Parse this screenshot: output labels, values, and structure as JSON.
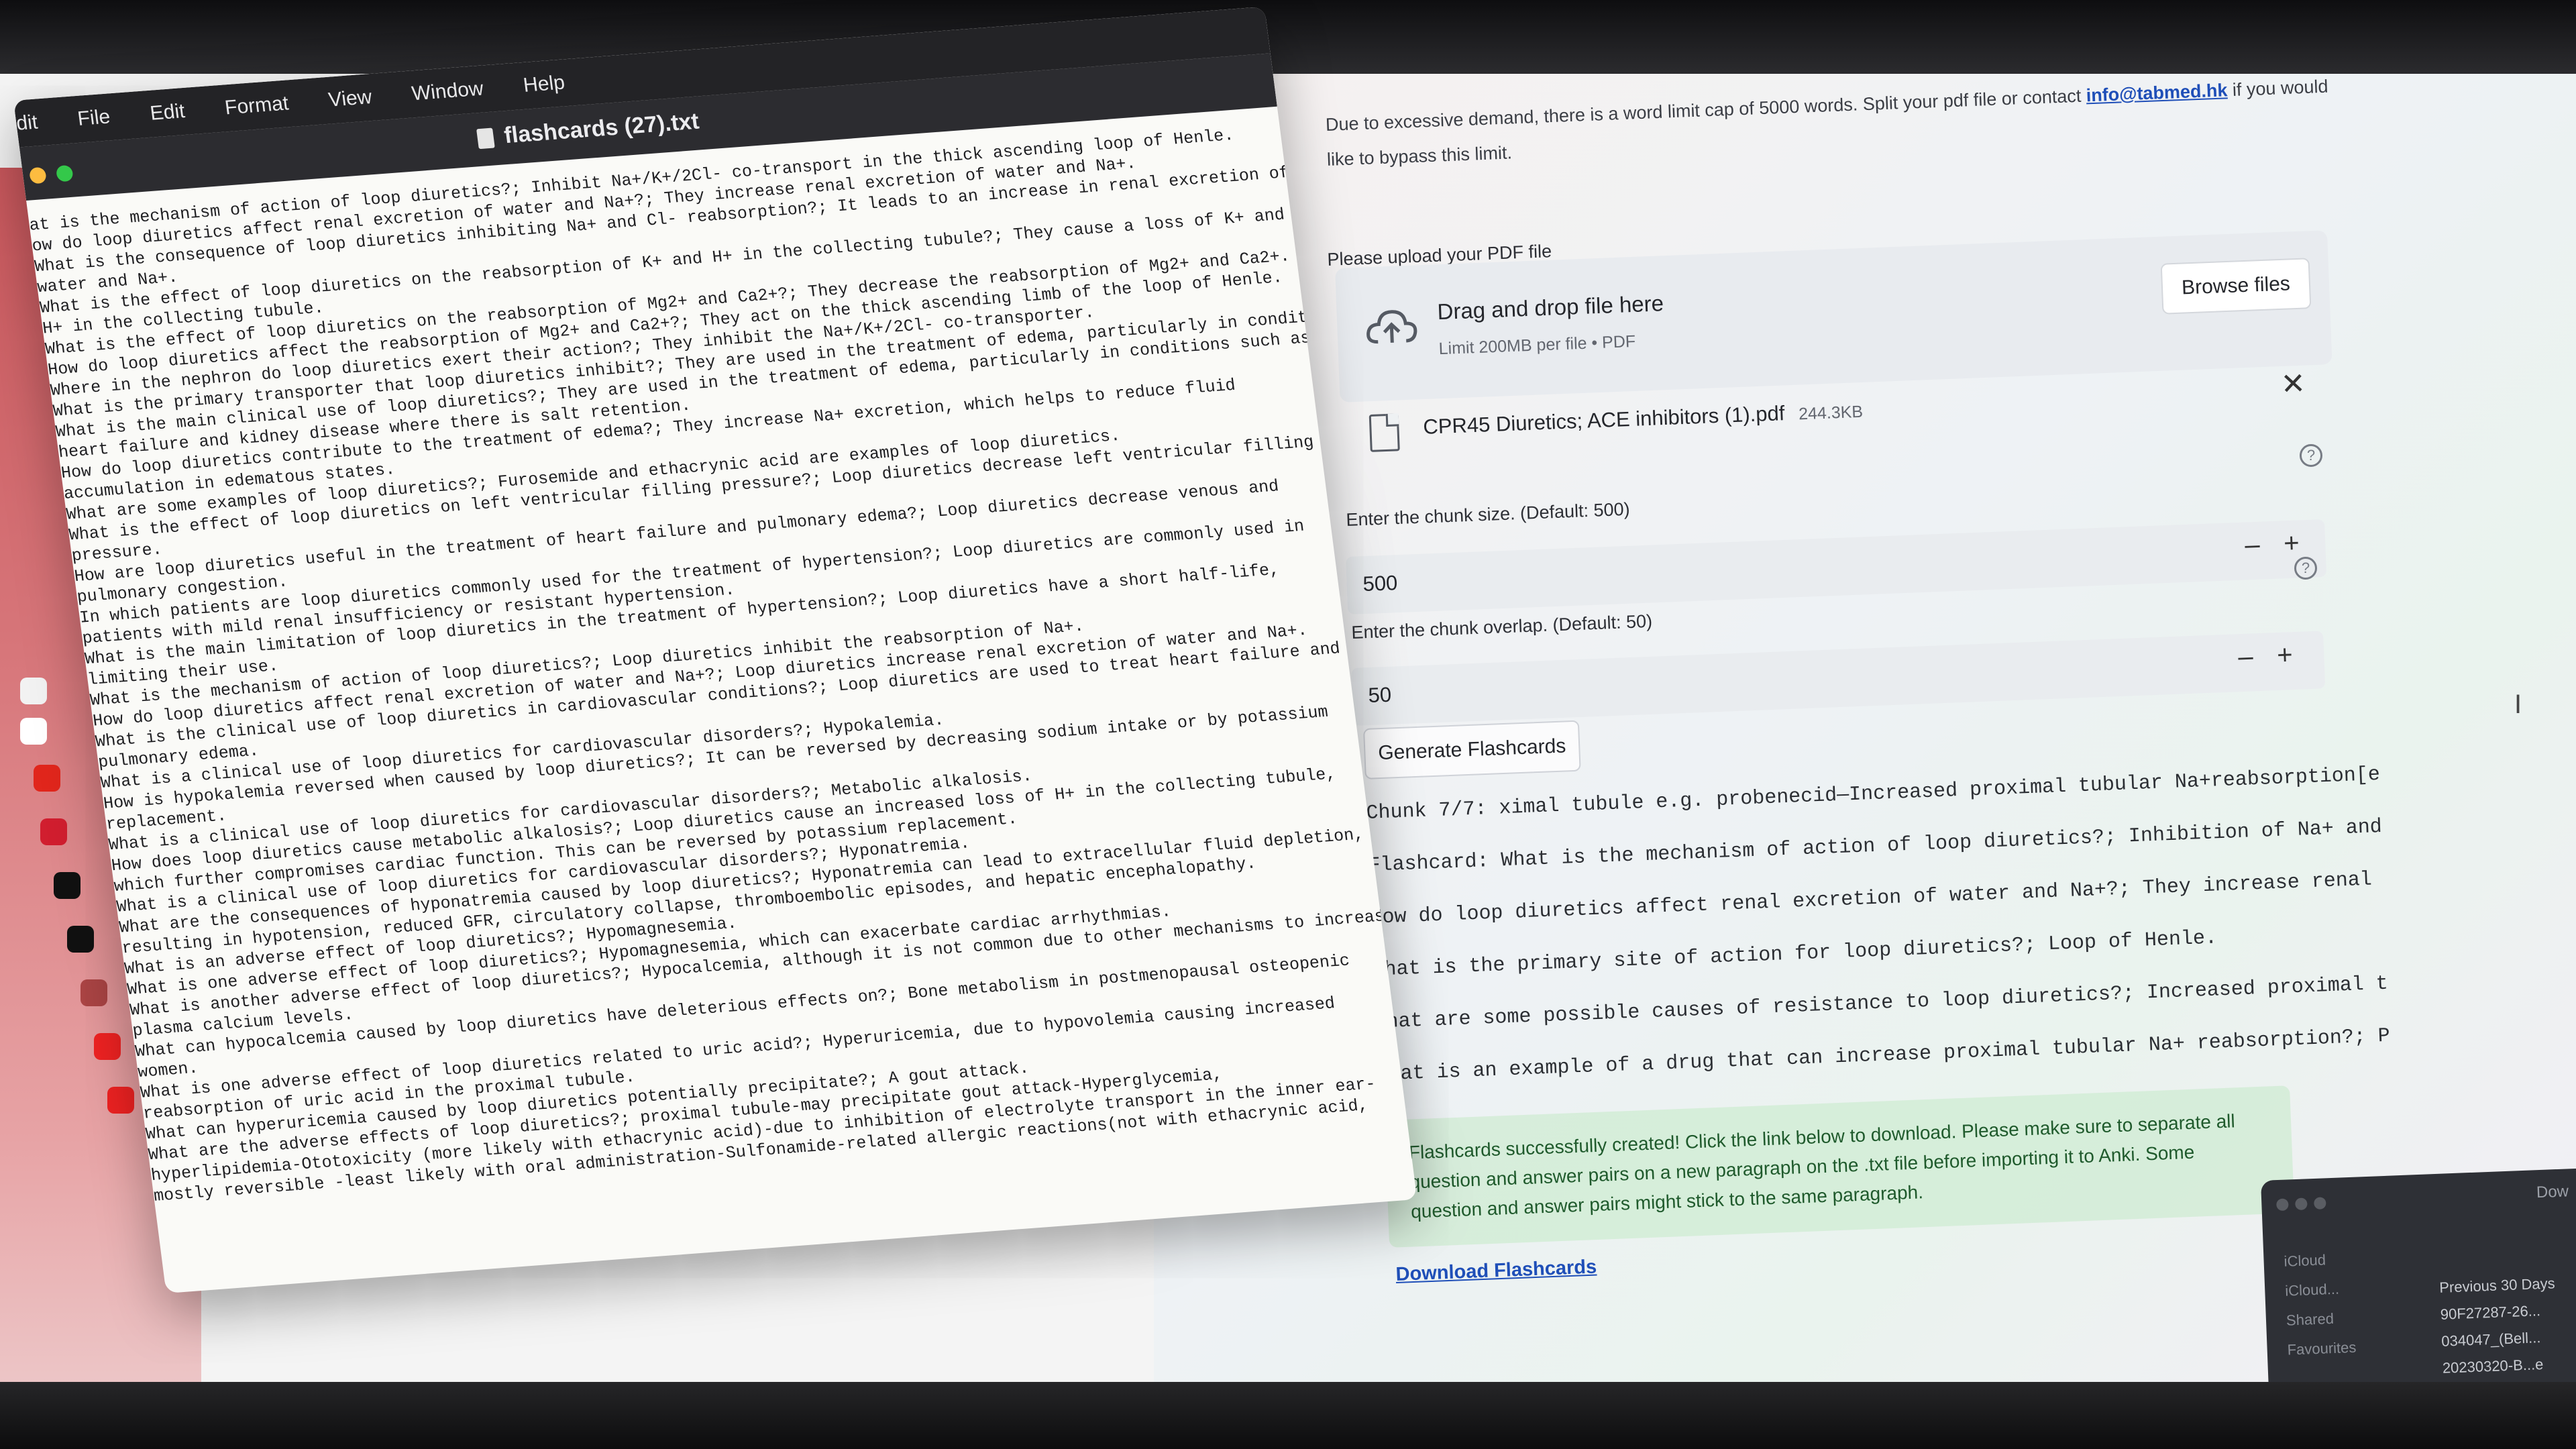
{
  "editor": {
    "menu": [
      "dit",
      "File",
      "Edit",
      "Format",
      "View",
      "Window",
      "Help"
    ],
    "title": "flashcards (27).txt",
    "lines": [
      "at is the mechanism of action of loop diuretics?; Inhibit Na+/K+/2Cl- co-transport in the thick ascending loop of Henle.",
      "ow do loop diuretics affect renal excretion of water and Na+?; They increase renal excretion of water and Na+.",
      "What is the consequence of loop diuretics inhibiting Na+ and Cl- reabsorption?; It leads to an increase in renal excretion of",
      "water and Na+.",
      "What is the effect of loop diuretics on the reabsorption of K+ and H+ in the collecting tubule?; They cause a loss of K+ and",
      "H+ in the collecting tubule.",
      "What is the effect of loop diuretics on the reabsorption of Mg2+ and Ca2+?; They decrease the reabsorption of Mg2+ and Ca2+.",
      "How do loop diuretics affect the reabsorption of Mg2+ and Ca2+?; They act on the thick ascending limb of the loop of Henle.",
      "Where in the nephron do loop diuretics exert their action?; They inhibit the Na+/K+/2Cl- co-transporter.",
      "What is the primary transporter that loop diuretics inhibit?; They are used in the treatment of edema, particularly in conditions such as",
      "What is the main clinical use of loop diuretics?; They are used in the treatment of edema, particularly in conditions such as",
      "heart failure and kidney disease where there is salt retention.",
      "How do loop diuretics contribute to the treatment of edema?; They increase Na+ excretion, which helps to reduce fluid",
      "accumulation in edematous states.",
      "What are some examples of loop diuretics?; Furosemide and ethacrynic acid are examples of loop diuretics.",
      "What is the effect of loop diuretics on left ventricular filling pressure?; Loop diuretics decrease left ventricular filling",
      "pressure.",
      "How are loop diuretics useful in the treatment of heart failure and pulmonary edema?; Loop diuretics decrease venous and",
      "pulmonary congestion.",
      "In which patients are loop diuretics commonly used for the treatment of hypertension?; Loop diuretics are commonly used in",
      "patients with mild renal insufficiency or resistant hypertension.",
      "What is the main limitation of loop diuretics in the treatment of hypertension?; Loop diuretics have a short half-life,",
      "limiting their use.",
      "What is the mechanism of action of loop diuretics?; Loop diuretics inhibit the reabsorption of Na+.",
      "How do loop diuretics affect renal excretion of water and Na+?; Loop diuretics increase renal excretion of water and Na+.",
      "What is the clinical use of loop diuretics in cardiovascular conditions?; Loop diuretics are used to treat heart failure and",
      "pulmonary edema.",
      "What is a clinical use of loop diuretics for cardiovascular disorders?; Hypokalemia.",
      "How is hypokalemia reversed when caused by loop diuretics?; It can be reversed by decreasing sodium intake or by potassium",
      "replacement.",
      "What is a clinical use of loop diuretics for cardiovascular disorders?; Metabolic alkalosis.",
      "How does loop diuretics cause metabolic alkalosis?; Loop diuretics cause an increased loss of H+ in the collecting tubule,",
      "which further compromises cardiac function. This can be reversed by potassium replacement.",
      "What is a clinical use of loop diuretics for cardiovascular disorders?; Hyponatremia.",
      "What are the consequences of hyponatremia caused by loop diuretics?; Hyponatremia can lead to extracellular fluid depletion,",
      "resulting in hypotension, reduced GFR, circulatory collapse, thromboembolic episodes, and hepatic encephalopathy.",
      "What is an adverse effect of loop diuretics?; Hypomagnesemia.",
      "What is one adverse effect of loop diuretics?; Hypomagnesemia, which can exacerbate cardiac arrhythmias.",
      "What is another adverse effect of loop diuretics?; Hypocalcemia, although it is not common due to other mechanisms to increase",
      "plasma calcium levels.",
      "What can hypocalcemia caused by loop diuretics have deleterious effects on?; Bone metabolism in postmenopausal osteopenic",
      "women.",
      "What is one adverse effect of loop diuretics related to uric acid?; Hyperuricemia, due to hypovolemia causing increased",
      "reabsorption of uric acid in the proximal tubule.",
      "What can hyperuricemia caused by loop diuretics potentially precipitate?; A gout attack.",
      "What are the adverse effects of loop diuretics?; proximal tubule-may precipitate gout attack-Hyperglycemia,",
      "hyperlipidemia-Ototoxicity (more likely with ethacrynic acid)-due to inhibition of electrolyte transport in the inner ear-",
      "mostly reversible -least likely with oral administration-Sulfonamide-related allergic reactions(not with ethacrynic acid,"
    ]
  },
  "page": {
    "notice_text": "Due to excessive demand, there is a word limit cap of 5000 words. Split your pdf file or contact ",
    "notice_email": "info@tabmed.hk",
    "notice_tail": " if you would like to bypass this limit.",
    "upload_label": "Please upload your PDF file",
    "drag_title": "Drag and drop file here",
    "drag_sub": "Limit 200MB per file • PDF",
    "browse_label": "Browse files",
    "file_name": "CPR45 Diuretics; ACE inhibitors (1).pdf",
    "file_size": "244.3KB",
    "chunk_size_label": "Enter the chunk size. (Default: 500)",
    "chunk_size_value": "500",
    "chunk_overlap_label": "Enter the chunk overlap. (Default: 50)",
    "chunk_overlap_value": "50",
    "generate_label": "Generate Flashcards",
    "output_lines": [
      "Chunk 7/7: ximal tubule e.g. probenecid—Increased proximal tubular Na+reabsorption[e",
      "Flashcard: What is the mechanism of action of loop diuretics?; Inhibition of Na+ and",
      "How do loop diuretics affect renal excretion of water and Na+?; They increase renal",
      "What is the primary site of action for loop diuretics?; Loop of Henle.",
      "What are some possible causes of resistance to loop diuretics?; Increased proximal t",
      "What is an example of a drug that can increase proximal tubular Na+ reabsorption?; P"
    ],
    "success_text": "Flashcards successfully created! Click the link below to download. Please make sure to separate all question and answer pairs on a new paragraph on the .txt file before importing it to Anki. Some question and answer pairs might stick to the same paragraph.",
    "download_label": "Download Flashcards"
  },
  "finder": {
    "header": "Dow",
    "sidebar": [
      "iCloud",
      "iCloud...",
      "Shared",
      "Favourites"
    ],
    "section": "Previous 30 Days",
    "files": [
      "90F27287-26...",
      "034047_(Bell...",
      "20230320-B...e"
    ]
  },
  "colors": {
    "link": "#1f4fb8",
    "success_bg": "#d2ecd6",
    "success_text": "#1f5a2c",
    "menu_bg": "#232326",
    "dock_bg": "#c9575c"
  },
  "icons": [
    "upload-cloud-icon",
    "file-icon",
    "close-icon",
    "help-icon",
    "minus-icon",
    "plus-icon",
    "text-cursor-icon",
    "document-icon"
  ]
}
